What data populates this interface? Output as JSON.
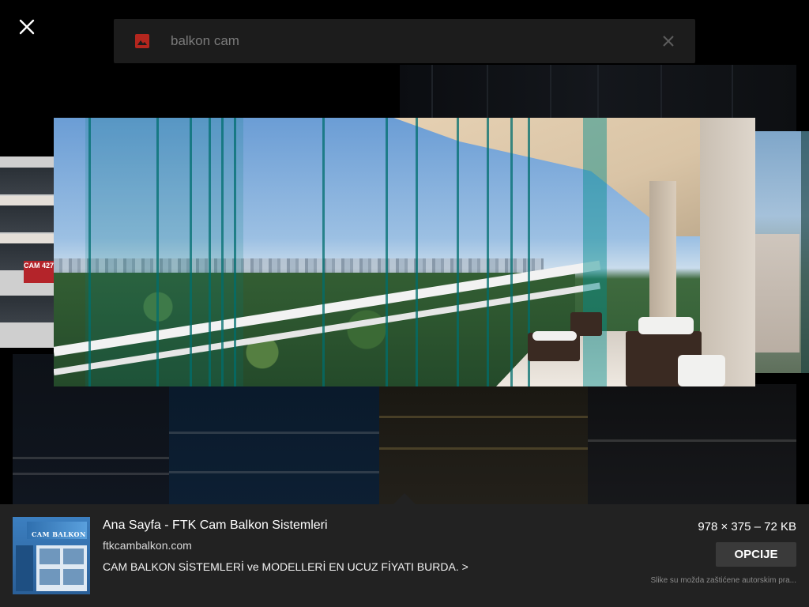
{
  "search": {
    "query": "balkon cam"
  },
  "icons": {
    "close": "close-icon",
    "image": "image-icon",
    "clear": "clear-icon"
  },
  "colors": {
    "background": "#000000",
    "panel": "#222222",
    "search_bar": "#1c1c1c",
    "image_icon": "#c62828",
    "button": "#3a3a3a"
  },
  "background_tiles": {
    "left_sign_text": "CAM 427"
  },
  "result": {
    "title": "Ana Sayfa - FTK Cam Balkon Sistemleri",
    "site": "ftkcambalkon.com",
    "description": "CAM BALKON SİSTEMLERİ ve MODELLERİ EN UCUZ FİYATI BURDA. >",
    "dimensions": "978 × 375 – 72 KB",
    "options_label": "OPCIJE",
    "copyright_note": "Slike su možda zaštićene autorskim pra...",
    "thumbnail_brand": "CAM BALKON"
  }
}
